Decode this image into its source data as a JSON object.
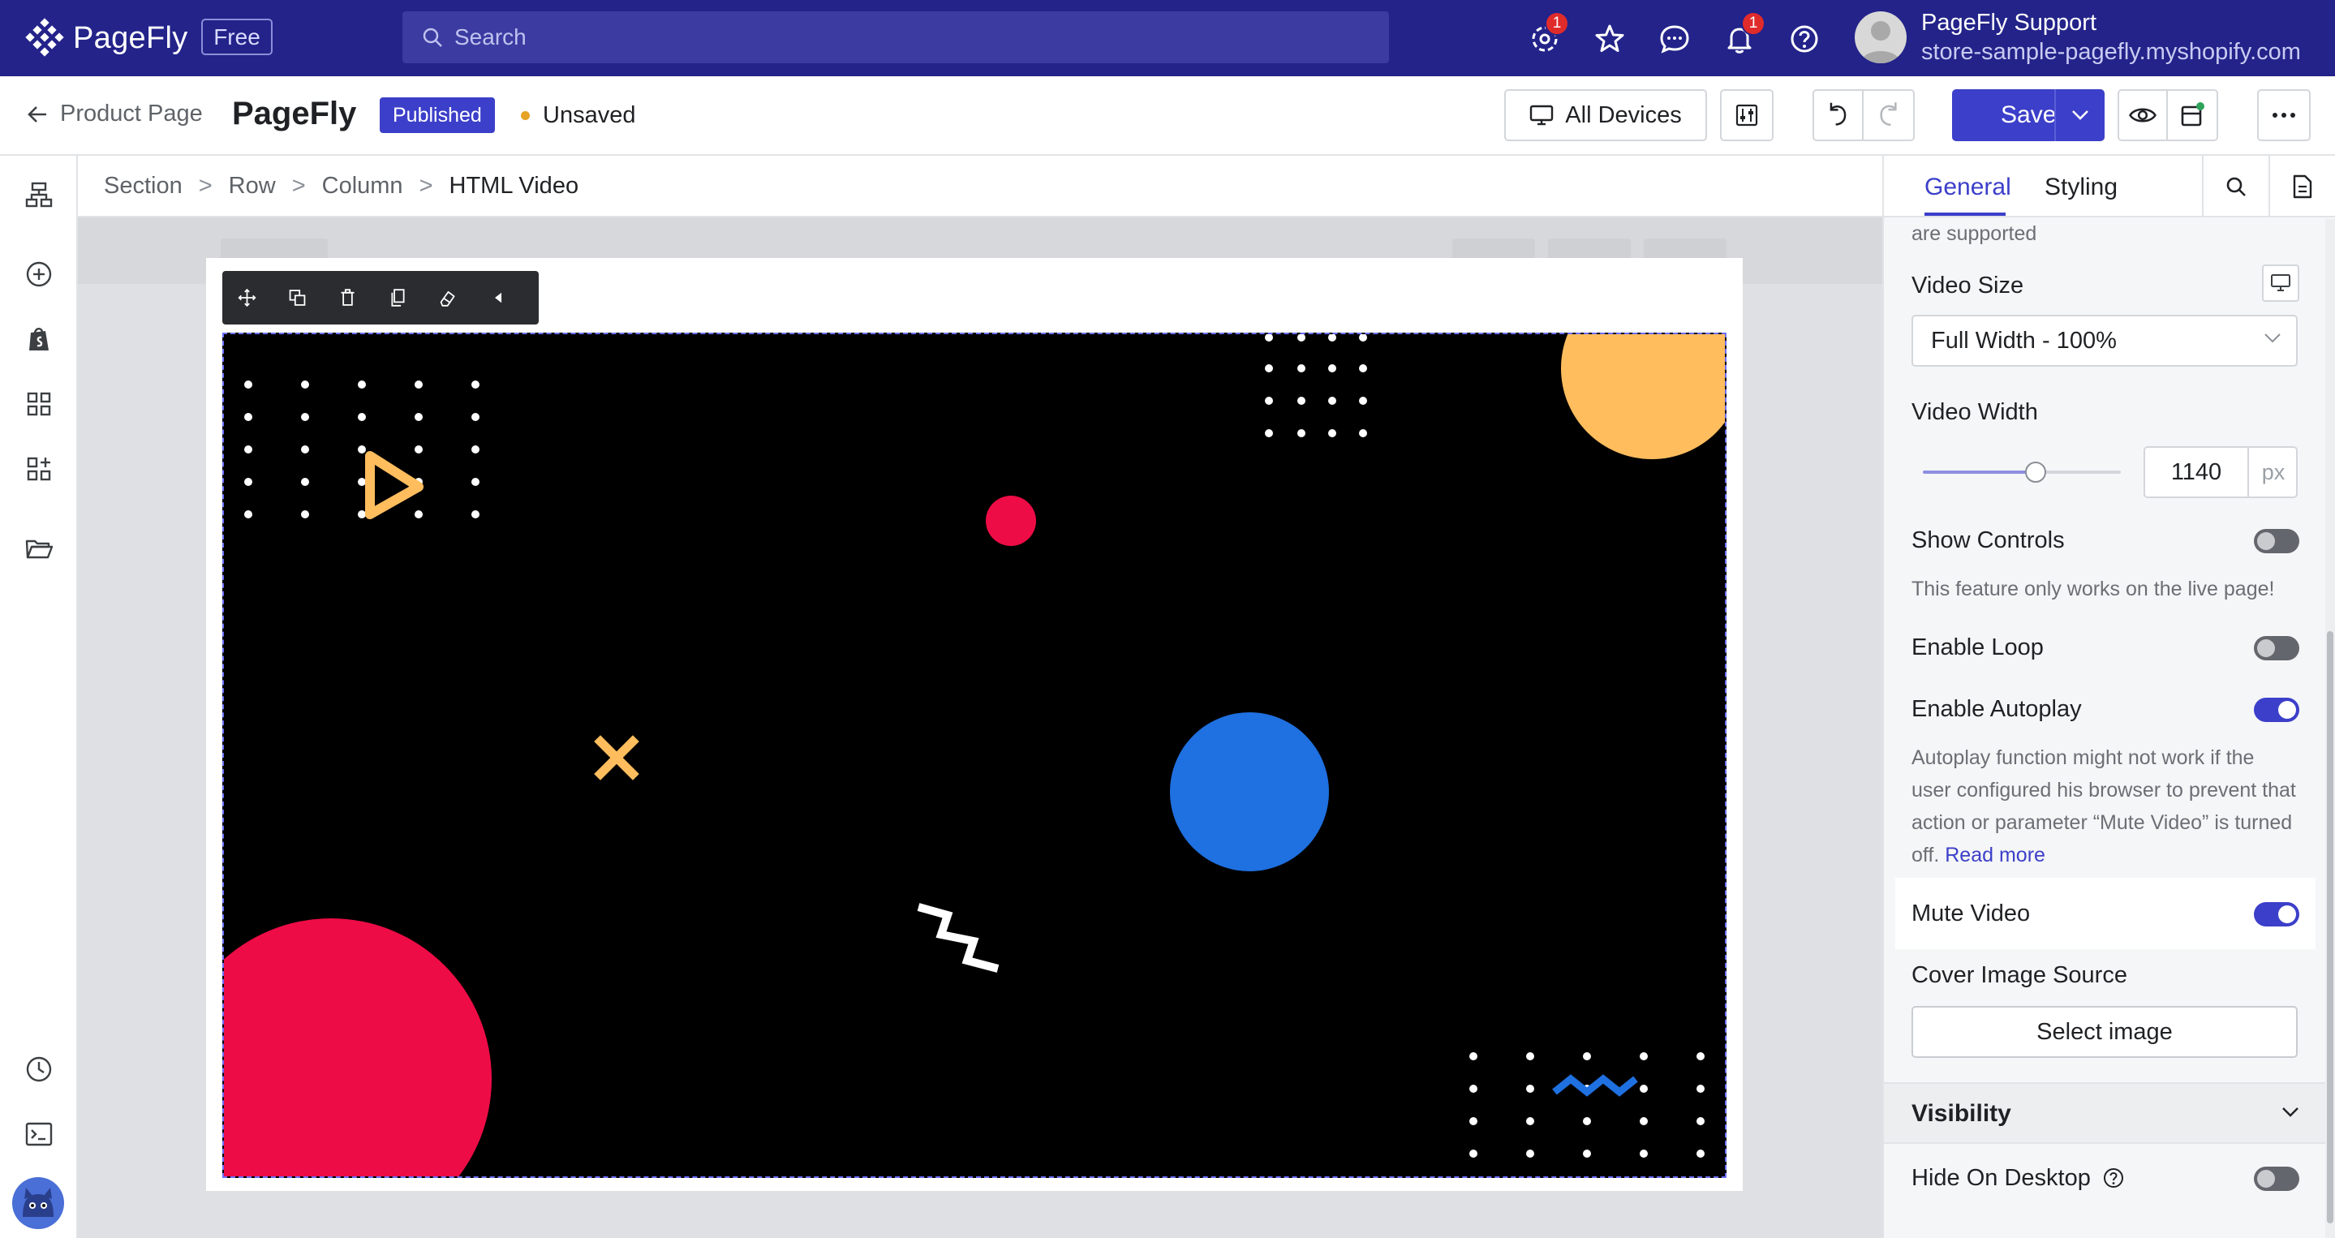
{
  "app": {
    "brand": "PageFly",
    "plan_badge": "Free",
    "search_placeholder": "Search",
    "notification_counts": {
      "updates": "1",
      "bell": "1"
    },
    "user": {
      "name": "PageFly Support",
      "store": "store-sample-pagefly.myshopify.com"
    }
  },
  "editor_bar": {
    "back_label": "Product Page",
    "page_brand": "PageFly",
    "status_badge": "Published",
    "save_state": "Unsaved",
    "devices_label": "All Devices",
    "save_label": "Save",
    "colors": {
      "primary": "#3c3fc9",
      "topbar": "#23238a",
      "unsaved_dot": "#e5a225"
    }
  },
  "breadcrumb": [
    "Section",
    "Row",
    "Column",
    "HTML Video"
  ],
  "right_panel": {
    "tabs": {
      "general": "General",
      "styling": "Styling"
    },
    "supported_tail": "are supported",
    "video_size": {
      "label": "Video Size",
      "value": "Full Width - 100%"
    },
    "video_width": {
      "label": "Video Width",
      "value": "1140",
      "unit": "px",
      "slider_fraction": 0.57
    },
    "show_controls": {
      "label": "Show Controls",
      "on": false,
      "help": "This feature only works on the live page!"
    },
    "enable_loop": {
      "label": "Enable Loop",
      "on": false
    },
    "enable_autoplay": {
      "label": "Enable Autoplay",
      "on": true,
      "help": "Autoplay function might not work if the user configured his browser to prevent that action or parameter “Mute Video” is turned off.",
      "read_more": "Read more"
    },
    "mute_video": {
      "label": "Mute Video",
      "on": true
    },
    "cover_image": {
      "label": "Cover Image Source",
      "button": "Select image"
    },
    "visibility": {
      "title": "Visibility"
    },
    "hide_on_desktop": {
      "label": "Hide On Desktop",
      "on": false
    }
  },
  "video_shapes": {
    "colors": {
      "red": "#ee0c46",
      "orange": "#ffbd5e",
      "blue": "#1f70e0",
      "white": "#ffffff",
      "background": "#000000"
    }
  }
}
